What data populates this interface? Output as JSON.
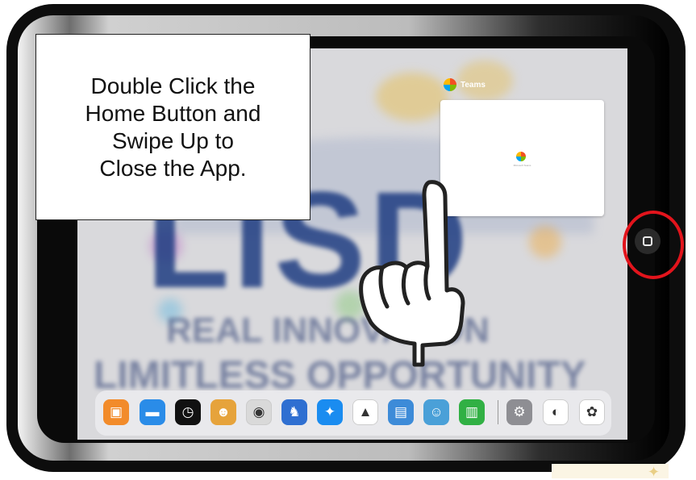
{
  "instruction": {
    "text": "Double Click the\nHome Button and\nSwipe Up to\nClose the App."
  },
  "app_switcher": {
    "app_name": "Teams",
    "card_caption": "Microsoft Teams"
  },
  "wallpaper": {
    "logo_text": "LISD",
    "line1": "REAL INNOVATION",
    "line2": "LIMITLESS OPPORTUNITY",
    "brand_color": "#2c3e73"
  },
  "dock": {
    "icons": [
      {
        "name": "keynote-remote-icon",
        "color": "#f28b2a",
        "glyph": "▣"
      },
      {
        "name": "keynote-icon",
        "color": "#2a8ce8",
        "glyph": "▬"
      },
      {
        "name": "clock-icon",
        "color": "#111111",
        "glyph": "◷"
      },
      {
        "name": "tiger-game-icon",
        "color": "#e6a33b",
        "glyph": "☻"
      },
      {
        "name": "camera-icon",
        "color": "#d9d9d9",
        "glyph": "◉"
      },
      {
        "name": "bunny-app-icon",
        "color": "#2f6fd1",
        "glyph": "♞"
      },
      {
        "name": "safari-icon",
        "color": "#1a8cf0",
        "glyph": "✦"
      },
      {
        "name": "google-drive-icon",
        "color": "#ffffff",
        "glyph": "▲"
      },
      {
        "name": "spelling-notebook-icon",
        "color": "#3d8bd8",
        "glyph": "▤"
      },
      {
        "name": "monster-game-icon",
        "color": "#4aa0d8",
        "glyph": "☺"
      },
      {
        "name": "numbers-icon",
        "color": "#31b044",
        "glyph": "▥"
      },
      {
        "name": "settings-icon",
        "color": "#8e8e93",
        "glyph": "⚙"
      },
      {
        "name": "teams-icon",
        "color": "#ffffff",
        "glyph": "◐"
      },
      {
        "name": "photos-icon",
        "color": "#ffffff",
        "glyph": "✿"
      }
    ]
  },
  "colors": {
    "highlight_circle": "#e2141c",
    "device_frame": "#0d0d0d"
  }
}
